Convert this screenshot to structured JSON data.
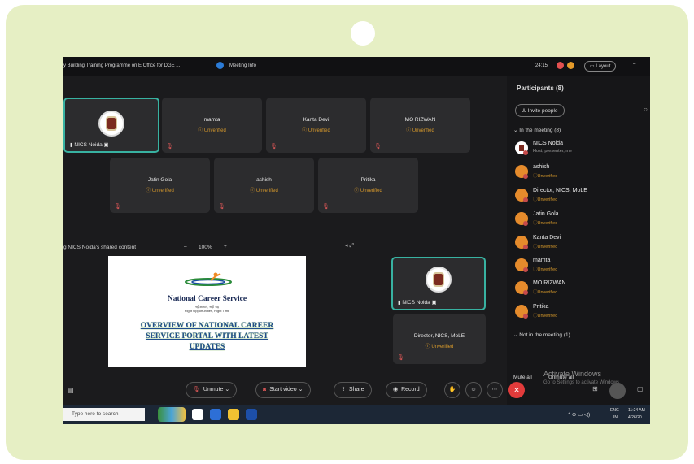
{
  "window": {
    "title": "y Building Training Programme on E Office for DGE ...",
    "meeting_info": "Meeting Info",
    "timer": "24:15",
    "layout_label": "Layout",
    "minimize": "–"
  },
  "tiles_row1": [
    {
      "name": "NICS Noida",
      "status": "",
      "active": true,
      "has_logo": true
    },
    {
      "name": "mamta",
      "status": "Unverified"
    },
    {
      "name": "Kanta Devi",
      "status": "Unverified"
    },
    {
      "name": "MO RIZWAN",
      "status": "Unverified"
    }
  ],
  "tiles_row2": [
    {
      "name": "Jatin Gola",
      "status": "Unverified"
    },
    {
      "name": "ashish",
      "status": "Unverified"
    },
    {
      "name": "Pritika",
      "status": "Unverified"
    }
  ],
  "shared": {
    "label": "g NICS Noida's shared content",
    "zoom_minus": "–",
    "zoom": "100%",
    "zoom_plus": "+"
  },
  "slide": {
    "org_name": "National Career Service",
    "tagline_1": "नई आशाएं, सही राह",
    "tagline_2": "Right Opportunities, Right Time",
    "heading": "OVERVIEW OF NATIONAL CAREER SERVICE PORTAL WITH LATEST UPDATES"
  },
  "side_tiles": [
    {
      "name": "NICS Noida",
      "active": true
    },
    {
      "name": "Director, NICS, MoLE",
      "status": "Unverified"
    }
  ],
  "participants": {
    "title": "Participants (8)",
    "invite_label": "Invite people",
    "in_meeting_label": "In the meeting (8)",
    "not_in_meeting_label": "Not in the meeting (1)",
    "list": [
      {
        "name": "NICS Noida",
        "sub": "Host, presenter, me",
        "host": true
      },
      {
        "name": "ashish",
        "sub": "Unverified"
      },
      {
        "name": "Director, NICS, MoLE",
        "sub": "Unverified"
      },
      {
        "name": "Jatin Gola",
        "sub": "Unverified"
      },
      {
        "name": "Kanta Devi",
        "sub": "Unverified"
      },
      {
        "name": "mamta",
        "sub": "Unverified"
      },
      {
        "name": "MO RIZWAN",
        "sub": "Unverified"
      },
      {
        "name": "Pritika",
        "sub": "Unverified"
      }
    ],
    "mute_all": "Mute all",
    "unmute_all": "Unmute all"
  },
  "controls": {
    "unmute": "Unmute",
    "start_video": "Start video",
    "share": "Share",
    "record": "Record"
  },
  "watermark": {
    "line1": "Activate Windows",
    "line2": "Go to Settings to activate Windows."
  },
  "taskbar": {
    "search_placeholder": "Type here to search",
    "lang_1": "ENG",
    "lang_2": "IN",
    "time": "11:24 AM",
    "date": "4/26/20"
  },
  "colors": {
    "frame_bg": "#e6efc4",
    "active_border": "#38b2a1",
    "unverified": "#d89a2b",
    "leave": "#e23b3b"
  }
}
